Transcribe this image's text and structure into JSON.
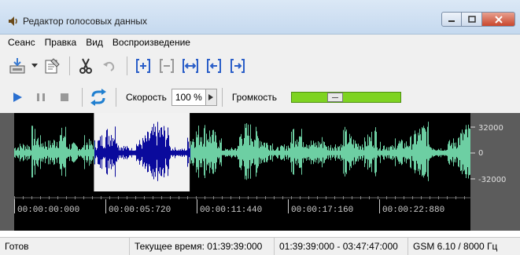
{
  "window": {
    "title": "Редактор голосовых данных"
  },
  "menu": [
    "Сеанс",
    "Правка",
    "Вид",
    "Воспроизведение"
  ],
  "toolbar2": {
    "speed_label": "Скорость",
    "speed_value": "100 %",
    "volume_label": "Громкость",
    "volume_level": 0.38
  },
  "waveform": {
    "selection_start": "00:00:05:000",
    "selection_end": "00:00:11:000",
    "amplitude_labels": [
      "32000",
      "0",
      "-32000"
    ],
    "time_labels": [
      "00:00:00:000",
      "00:00:05:720",
      "00:00:11:440",
      "00:00:17:160",
      "00:00:22:880"
    ],
    "colors": {
      "wave": "#6dcfa3",
      "wave_selected": "#0a0a9c",
      "selection_bg": "#f2f2f2",
      "background": "#000000"
    }
  },
  "status": {
    "state": "Готов",
    "current_time": "Текущее время: 01:39:39:000",
    "range": "01:39:39:000 - 03:47:47:000",
    "format": "GSM 6.10 / 8000 Гц"
  }
}
